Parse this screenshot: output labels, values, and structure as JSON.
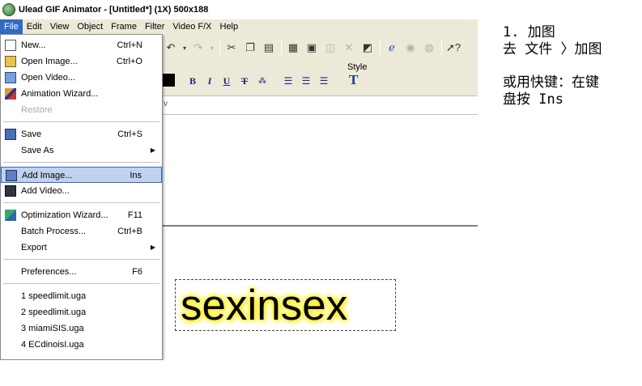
{
  "window": {
    "title": "Ulead GIF Animator - [Untitled*] (1X) 500x188"
  },
  "menubar": {
    "items": [
      "File",
      "Edit",
      "View",
      "Object",
      "Frame",
      "Filter",
      "Video F/X",
      "Help"
    ],
    "active": "File"
  },
  "file_menu": {
    "items": [
      {
        "label": "New...",
        "shortcut": "Ctrl+N",
        "icon": "new-document-icon"
      },
      {
        "label": "Open Image...",
        "shortcut": "Ctrl+O",
        "icon": "open-folder-icon"
      },
      {
        "label": "Open Video...",
        "shortcut": "",
        "icon": "open-video-icon"
      },
      {
        "label": "Animation Wizard...",
        "shortcut": "",
        "icon": "wizard-wand-icon"
      },
      {
        "label": "Restore",
        "shortcut": "",
        "disabled": true
      },
      {
        "label": "Save",
        "shortcut": "Ctrl+S",
        "icon": "save-disk-icon"
      },
      {
        "label": "Save As",
        "shortcut": "",
        "submenu": true
      },
      {
        "label": "Add Image...",
        "shortcut": "Ins",
        "icon": "add-image-icon",
        "highlighted": true
      },
      {
        "label": "Add Video...",
        "shortcut": "",
        "icon": "add-video-icon"
      },
      {
        "label": "Optimization Wizard...",
        "shortcut": "F11",
        "icon": "optimization-wizard-icon"
      },
      {
        "label": "Batch Process...",
        "shortcut": "Ctrl+B"
      },
      {
        "label": "Export",
        "shortcut": "",
        "submenu": true
      },
      {
        "label": "Preferences...",
        "shortcut": "F6"
      },
      {
        "label": "1 speedlimit.uga"
      },
      {
        "label": "2 speedlimit.uga"
      },
      {
        "label": "3 miamiSIS.uga"
      },
      {
        "label": "4 ECdinoisI.uga"
      }
    ]
  },
  "format_toolbar": {
    "style_label": "Style",
    "bold": "B",
    "italic": "I",
    "underline": "U",
    "strike": "T",
    "style_glyph": "T"
  },
  "canvas": {
    "text_object": "sexinsex",
    "glow_color": "#fff000"
  },
  "notes": {
    "line1": "1. 加图",
    "line2": "去 文件 〉加图",
    "line3": "或用快键：在键",
    "line4": "盘按 Ins"
  },
  "colors": {
    "menu_highlight": "#c1d2ee",
    "menu_highlight_border": "#316ac5",
    "active_menu": "#316ac5"
  }
}
